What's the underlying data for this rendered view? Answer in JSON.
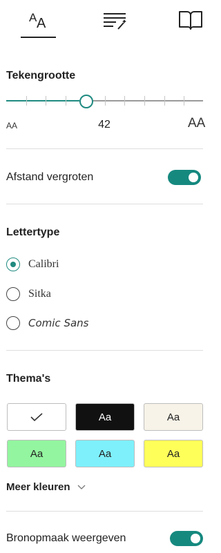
{
  "tabs": [
    {
      "icon": "text-size-icon",
      "selected": true
    },
    {
      "icon": "text-magic-icon",
      "selected": false
    },
    {
      "icon": "book-icon",
      "selected": false
    }
  ],
  "text_size": {
    "title": "Tekengrootte",
    "value": "42",
    "small_glyph": "AA",
    "large_glyph": "AA",
    "level": 0.38
  },
  "spacing": {
    "label": "Afstand vergroten",
    "on": true
  },
  "font": {
    "title": "Lettertype",
    "options": [
      {
        "label": "Calibri",
        "selected": true
      },
      {
        "label": "Sitka",
        "selected": false
      },
      {
        "label": "Comic Sans",
        "selected": false
      }
    ]
  },
  "themes": {
    "title": "Thema's",
    "swatches": [
      {
        "label": "",
        "bg": "#ffffff",
        "fg": "#222222",
        "selected": true
      },
      {
        "label": "Aa",
        "bg": "#111111",
        "fg": "#ffffff",
        "selected": false
      },
      {
        "label": "Aa",
        "bg": "#f7f3e8",
        "fg": "#222222",
        "selected": false
      },
      {
        "label": "Aa",
        "bg": "#93f59f",
        "fg": "#222222",
        "selected": false
      },
      {
        "label": "Aa",
        "bg": "#7ef0fb",
        "fg": "#222222",
        "selected": false
      },
      {
        "label": "Aa",
        "bg": "#ffff5a",
        "fg": "#222222",
        "selected": false
      }
    ],
    "more_colors": "Meer kleuren"
  },
  "source_format": {
    "label": "Bronopmaak weergeven",
    "on": true
  },
  "colors": {
    "accent": "#1f8a80",
    "toggle": "#16897f"
  }
}
